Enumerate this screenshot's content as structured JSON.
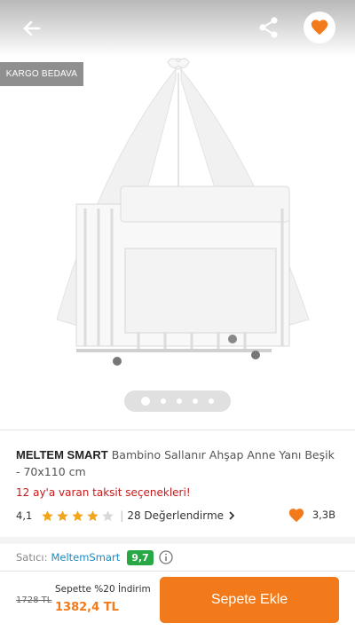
{
  "header": {
    "back_icon": "arrow-left-icon",
    "share_icon": "share-icon",
    "favorite_icon": "heart-icon"
  },
  "gallery": {
    "badge": "KARGO BEDAVA",
    "image_alt": "Bambino Sallanır Ahşap Anne Yanı Beşik",
    "slide_count": 5,
    "active_slide": 1
  },
  "product": {
    "brand": "MELTEM SMART",
    "name": " Bambino Sallanır Ahşap Anne Yanı Beşik - 70x110 cm",
    "installment": "12 ay'a varan taksit seçenekleri!",
    "rating": "4,1",
    "stars": 4,
    "reviews_link": "28 Değerlendirme",
    "favorites_count": "3,3B"
  },
  "seller": {
    "label": "Satıcı:",
    "name": "MeltemSmart",
    "score": "9,7"
  },
  "bottom_bar": {
    "old_price": "1728 TL",
    "discount_label": "Sepette %20 İndirim",
    "new_price": "1382,4 TL",
    "cart_button": "Sepete Ekle"
  },
  "colors": {
    "accent": "#f27a1a",
    "star": "#f2a51a",
    "installment": "#c41a1a",
    "seller_link": "#1a8cc6",
    "score_badge": "#28a745"
  }
}
